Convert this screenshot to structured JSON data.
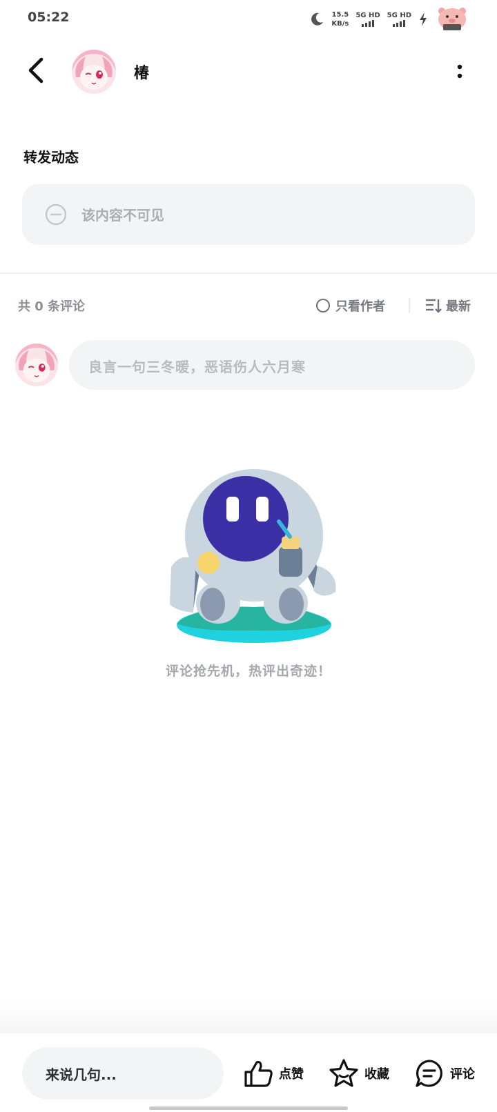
{
  "status_bar": {
    "time": "05:22",
    "net_speed_value": "15.5",
    "net_speed_unit": "KB/s",
    "sim1": "5G HD",
    "sim2": "5G HD"
  },
  "header": {
    "user_name": "椿"
  },
  "repost": {
    "title": "转发动态",
    "hidden_text": "该内容不可见"
  },
  "comments": {
    "count_text": "共 0 条评论",
    "only_author": "只看作者",
    "sort_label": "最新",
    "input_placeholder": "良言一句三冬暖，恶语伤人六月寒",
    "empty_text": "评论抢先机，热评出奇迹！"
  },
  "bottom_bar": {
    "input_placeholder": "来说几句...",
    "like_label": "点赞",
    "favorite_label": "收藏",
    "comment_label": "评论"
  },
  "colors": {
    "card_bg": "#f3f4f6",
    "muted_text": "#a9aeb5",
    "robot_face": "#3b2fa6",
    "base_teal": "#1fd2e0"
  }
}
